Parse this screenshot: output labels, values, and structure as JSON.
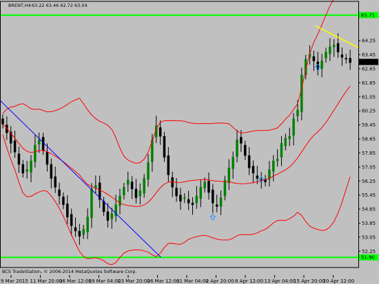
{
  "header": {
    "symbol": "BRENT,H4",
    "ohlc": "63.22 63.46 62.72 63.04"
  },
  "copyright": "BCS TradeStation, © 2006-2014 MetaQuotes Software Corp.",
  "colors": {
    "background": "#c0c0c0",
    "bull_candle": "#008000",
    "bear_candle": "#000000",
    "bands": "#ff0000",
    "trendline_blue": "#0000ff",
    "trendline_yellow": "#ffff00",
    "level_line": "#00ff00",
    "arrows": "#1e90ff"
  },
  "chart_data": {
    "type": "candlestick",
    "symbol": "BRENT",
    "timeframe": "H4",
    "current_price": "63.04",
    "level_price": "65.71",
    "bottom_level_price": "51.90",
    "ylim": [
      52.25,
      65.71
    ],
    "yticks": [
      "64.25",
      "63.45",
      "62.65",
      "61.85",
      "61.05",
      "60.25",
      "59.45",
      "58.65",
      "57.85",
      "57.05",
      "56.25",
      "55.45",
      "54.65",
      "53.85",
      "53.05",
      "52.25"
    ],
    "xticks": [
      "9 Mar 2015",
      "11 Mar 20:00",
      "16 Mar 12:00",
      "19 Mar 04:00",
      "23 Mar 20:00",
      "26 Mar 12:00",
      "31 Mar 04:00",
      "2 Apr 20:00",
      "8 Apr 12:00",
      "13 Apr 04:00",
      "15 Apr 20:00",
      "20 Apr 12:00"
    ],
    "closes": [
      59.5,
      59.0,
      58.4,
      57.9,
      57.2,
      56.7,
      56.9,
      57.4,
      58.3,
      58.6,
      58.0,
      57.2,
      56.4,
      55.9,
      55.4,
      54.9,
      54.2,
      53.7,
      53.4,
      53.1,
      53.5,
      54.2,
      55.8,
      56.0,
      55.2,
      54.5,
      54.0,
      54.4,
      54.9,
      55.4,
      55.9,
      56.3,
      55.8,
      55.3,
      55.7,
      56.4,
      57.3,
      58.6,
      59.4,
      58.8,
      57.6,
      56.6,
      55.9,
      55.4,
      55.1,
      55.3,
      55.0,
      54.9,
      55.4,
      55.9,
      56.2,
      55.6,
      55.0,
      54.8,
      55.3,
      56.3,
      57.0,
      57.6,
      58.6,
      58.4,
      57.7,
      57.0,
      56.7,
      56.4,
      56.3,
      56.2,
      56.9,
      57.4,
      57.5,
      58.4,
      58.7,
      58.8,
      59.8,
      60.3,
      62.3,
      63.2,
      63.5,
      63.1,
      62.6,
      63.1,
      63.6,
      63.9,
      64.0,
      63.6,
      63.3,
      63.2,
      63.0
    ]
  },
  "arrows": [
    {
      "label": "up-arrow",
      "price": 62.75
    },
    {
      "label": "up-arrow",
      "price": 56.35
    },
    {
      "label": "up-arrow",
      "price": 54.2
    }
  ]
}
